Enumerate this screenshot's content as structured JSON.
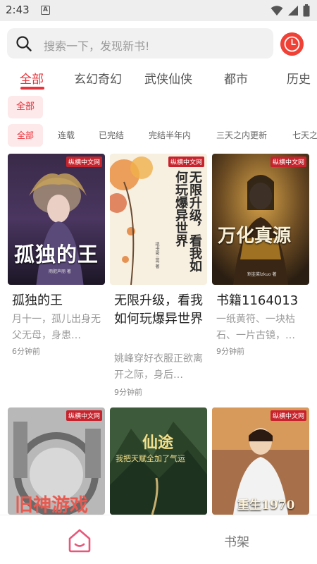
{
  "status_bar": {
    "time": "2:43",
    "notification_letter": "A"
  },
  "search": {
    "placeholder": "搜索一下，发现新书!"
  },
  "tabs": [
    {
      "label": "全部",
      "active": true
    },
    {
      "label": "玄幻奇幻",
      "active": false
    },
    {
      "label": "武侠仙侠",
      "active": false
    },
    {
      "label": "都市",
      "active": false
    },
    {
      "label": "历史",
      "active": false
    }
  ],
  "category_chip": "全部",
  "filters": [
    "全部",
    "连载",
    "已完结",
    "完结半年内",
    "三天之内更新",
    "七天之"
  ],
  "books": [
    {
      "title": "孤独的王",
      "desc": "月十一，孤儿出身无父无母，身患…",
      "time": "6分钟前",
      "cover_badge": "纵横中文网",
      "cover_text": "孤独的王",
      "cover_author": "雨肥声丽 著"
    },
    {
      "title": "无限升级，看我如何玩爆异世界",
      "desc": "姚峰穿好衣服正欲离开之际，身后…",
      "time": "9分钟前",
      "cover_badge": "纵横中文网",
      "cover_text": "无限升级，看我如何玩爆异世界",
      "cover_author": "把书哥三哥 著"
    },
    {
      "title": "书籍1164013",
      "desc": "一纸黄符、一块枯石、一片古镜，…",
      "time": "9分钟前",
      "cover_badge": "纵横中文网",
      "cover_text": "万化真源",
      "cover_author": "割韭菜lzkuo 著"
    },
    {
      "title": "",
      "desc": "",
      "time": "",
      "cover_badge": "纵横中文网",
      "cover_text": "旧神游戏"
    },
    {
      "title": "",
      "desc": "",
      "time": "",
      "cover_badge": "",
      "cover_text": "仙途",
      "cover_subtext": "我把天赋全加了气运"
    },
    {
      "title": "",
      "desc": "",
      "time": "",
      "cover_badge": "纵横中文网",
      "cover_text": "重生1970"
    }
  ],
  "bottom_nav": {
    "shelf_label": "书架"
  },
  "colors": {
    "accent": "#e8333a",
    "chip_bg": "#fde8ea",
    "clock": "#f04136"
  }
}
